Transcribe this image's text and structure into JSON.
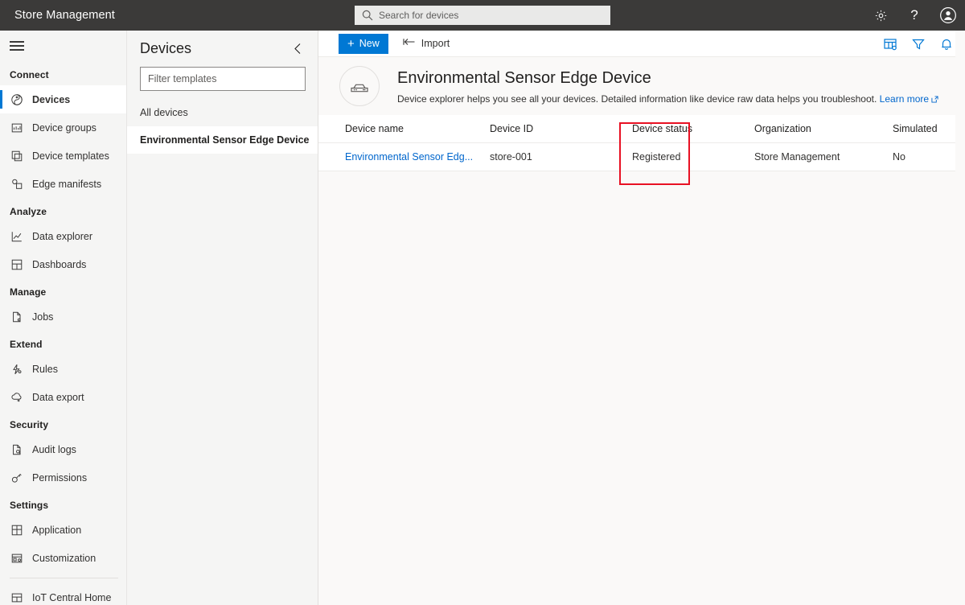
{
  "topbar": {
    "brand": "Store Management",
    "search_placeholder": "Search for devices",
    "icons": {
      "search": "search-icon",
      "settings": "gear-icon",
      "help": "?",
      "account": "account-icon"
    }
  },
  "sidebar": {
    "menu_icon": "hamburger-icon",
    "groups": [
      {
        "label": "Connect",
        "items": [
          {
            "label": "Devices",
            "icon": "devices-icon",
            "selected": true
          },
          {
            "label": "Device groups",
            "icon": "device-groups-icon",
            "selected": false
          },
          {
            "label": "Device templates",
            "icon": "device-templates-icon",
            "selected": false
          },
          {
            "label": "Edge manifests",
            "icon": "edge-manifests-icon",
            "selected": false
          }
        ]
      },
      {
        "label": "Analyze",
        "items": [
          {
            "label": "Data explorer",
            "icon": "chart-line-icon",
            "selected": false
          },
          {
            "label": "Dashboards",
            "icon": "dashboard-icon",
            "selected": false
          }
        ]
      },
      {
        "label": "Manage",
        "items": [
          {
            "label": "Jobs",
            "icon": "jobs-icon",
            "selected": false
          }
        ]
      },
      {
        "label": "Extend",
        "items": [
          {
            "label": "Rules",
            "icon": "rules-icon",
            "selected": false
          },
          {
            "label": "Data export",
            "icon": "data-export-icon",
            "selected": false
          }
        ]
      },
      {
        "label": "Security",
        "items": [
          {
            "label": "Audit logs",
            "icon": "audit-logs-icon",
            "selected": false
          },
          {
            "label": "Permissions",
            "icon": "key-icon",
            "selected": false
          }
        ]
      },
      {
        "label": "Settings",
        "items": [
          {
            "label": "Application",
            "icon": "application-icon",
            "selected": false
          },
          {
            "label": "Customization",
            "icon": "customization-icon",
            "selected": false
          }
        ]
      }
    ],
    "footer_item": {
      "label": "IoT Central Home",
      "icon": "home-grid-icon"
    }
  },
  "templates_panel": {
    "title": "Devices",
    "collapse_icon": "chevron-left-icon",
    "filter_placeholder": "Filter templates",
    "items": [
      {
        "label": "All devices",
        "selected": false
      },
      {
        "label": "Environmental Sensor Edge Device",
        "selected": true
      }
    ]
  },
  "commandbar": {
    "new_label": "New",
    "new_plus": "+",
    "import_label": "Import",
    "import_icon": "import-icon",
    "right_icons": [
      {
        "name": "column-options-icon"
      },
      {
        "name": "filter-icon"
      },
      {
        "name": "bell-icon"
      }
    ]
  },
  "hero": {
    "avatar_icon": "edge-device-icon",
    "title": "Environmental Sensor Edge Device",
    "description": "Device explorer helps you see all your devices. Detailed information like device raw data helps you troubleshoot.",
    "learn_more": "Learn more",
    "external_link_icon": "external-link-icon"
  },
  "table": {
    "columns": [
      "Device name",
      "Device ID",
      "Device status",
      "Organization",
      "Simulated"
    ],
    "rows": [
      {
        "device_name": "Environmental Sensor Edg...",
        "device_id": "store-001",
        "device_status": "Registered",
        "organization": "Store Management",
        "simulated": "No"
      }
    ]
  },
  "annotation": {
    "highlight_color": "#e81123",
    "target": "Device status column"
  }
}
